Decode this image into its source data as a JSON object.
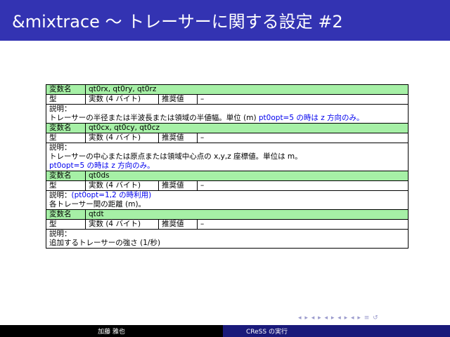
{
  "title": "&mixtrace ～ トレーサーに関する設定 #2",
  "labels": {
    "varname": "変数名",
    "type": "型",
    "recommended": "推奨値",
    "description": "説明："
  },
  "vars": [
    {
      "name": "qt0rx, qt0ry, qt0rz",
      "type": "実数 (4 バイト)",
      "recommended": "–",
      "desc_line1": "",
      "desc_line2": "トレーサーの半径または半波長または領域の半値幅。単位 (m) ",
      "desc_blue": "pt0opt=5 の時は z 方向のみ。"
    },
    {
      "name": "qt0cx, qt0cy, qt0cz",
      "type": "実数 (4 バイト)",
      "recommended": "–",
      "desc_line2": "トレーサーの中心または原点または領域中心点の x,y,z 座標値。単位は m。",
      "desc_blue": "pt0opt=5 の時は z 方向のみ。"
    },
    {
      "name": "qt0ds",
      "type": "実数 (4 バイト)",
      "recommended": "–",
      "desc_blue_inline": "(pt0opt=1,2 の時利用)",
      "desc_line2": "各トレーサー間の距離 (m)。"
    },
    {
      "name": "qtdt",
      "type": "実数 (4 バイト)",
      "recommended": "–",
      "desc_line2": "追加するトレーサーの強さ (1/秒)"
    }
  ],
  "footer": {
    "author": "加藤 雅也",
    "short_title": "CReSS の実行"
  },
  "nav_symbols": "◂ ▸ ◂ ▸ ◂ ▸ ◂ ▸ ◂ ▸  ≡  ↺",
  "colors": {
    "titlebar": "#3333b2",
    "header_row": "#a6f0a6",
    "link_blue": "#0000ee"
  }
}
